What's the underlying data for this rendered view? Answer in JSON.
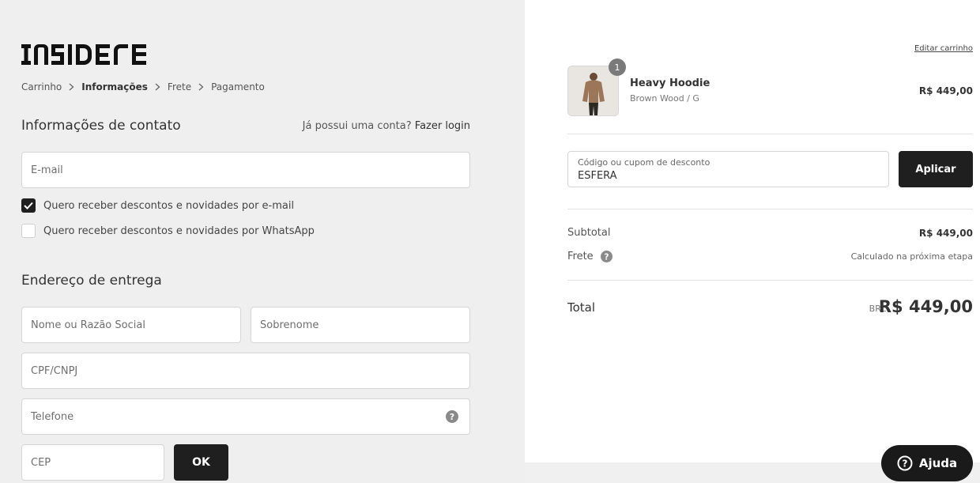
{
  "brand": {
    "logo_text": "INSIDER"
  },
  "breadcrumb": [
    {
      "label": "Carrinho"
    },
    {
      "label": "Informações",
      "current": true
    },
    {
      "label": "Frete"
    },
    {
      "label": "Pagamento"
    }
  ],
  "contact": {
    "title": "Informações de contato",
    "login_prompt": "Já possui uma conta?",
    "login_link": "Fazer login",
    "email_placeholder": "E-mail",
    "opt_email_label": "Quero receber descontos e novidades por e-mail",
    "opt_email_checked": true,
    "opt_whatsapp_label": "Quero receber descontos e novidades por WhatsApp",
    "opt_whatsapp_checked": false
  },
  "shipping": {
    "title": "Endereço de entrega",
    "first_name_placeholder": "Nome ou Razão Social",
    "last_name_placeholder": "Sobrenome",
    "document_placeholder": "CPF/CNPJ",
    "phone_placeholder": "Telefone",
    "cep_placeholder": "CEP",
    "ok_label": "OK"
  },
  "cart": {
    "edit_label": "Editar carrinho",
    "item": {
      "quantity": "1",
      "name": "Heavy Hoodie",
      "variant": "Brown Wood / G",
      "price": "R$ 449,00"
    },
    "coupon_label": "Código ou cupom de desconto",
    "coupon_value": "ESFERA",
    "apply_label": "Aplicar",
    "subtotal_label": "Subtotal",
    "subtotal_value": "R$ 449,00",
    "shipping_label": "Frete",
    "shipping_value": "Calculado na próxima etapa",
    "total_label": "Total",
    "total_currency": "BRL",
    "total_value": "R$ 449,00"
  },
  "help_button": {
    "label": "Ajuda"
  },
  "icons": {
    "chevron": "chevron-right-icon",
    "check": "check-icon",
    "question": "question-circle-icon"
  },
  "colors": {
    "dark_button": "#1f1f1f",
    "left_bg": "#efefef",
    "right_bg": "#ffffff"
  }
}
